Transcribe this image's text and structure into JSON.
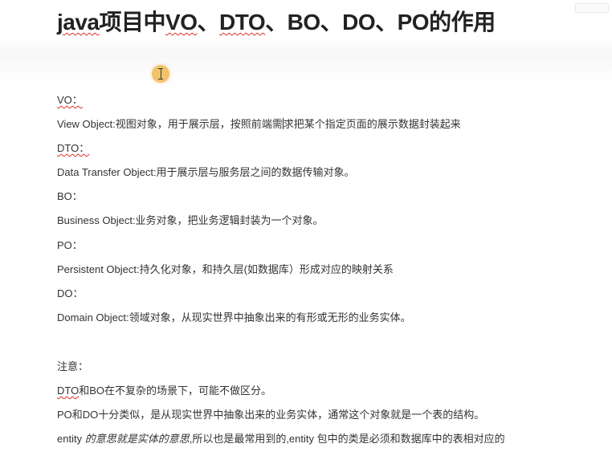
{
  "title": {
    "part1": "java",
    "part2": "项目中",
    "part3": "VO",
    "part4": "、",
    "part5": "DTO",
    "part6": "、BO、DO、PO的作用"
  },
  "sections": {
    "vo_label": "VO：",
    "vo_desc_a": "View Object:视图对象，用于展示层，按照前端需",
    "vo_desc_b": "求把某个指定页面的展示数据封装起来",
    "dto_label": "DTO：",
    "dto_desc": "Data Transfer Object:用于展示层与服务层之间的数据传输对象。",
    "bo_label": "BO：",
    "bo_desc": "Business Object:业务对象，把业务逻辑封装为一个对象。",
    "po_label": "PO：",
    "po_desc": "Persistent Object:持久化对象，和持久层(如数据库）形成对应的映射关系",
    "do_label": "DO：",
    "do_desc": "Domain Object:领域对象，从现实世界中抽象出来的有形或无形的业务实体。"
  },
  "notes": {
    "label": "注意：",
    "line1_a": "DTO",
    "line1_b": "和BO在不复杂的场景下，可能不做区分。",
    "line2": "PO和DO十分类似，是从现实世界中抽象出来的业务实体，通常这个对象就是一个表的结构。",
    "line3_a": "entity ",
    "line3_b": "的意思就是实体的意思",
    "line3_c": ",所以也是最常用到的,entity 包中的类是必须和数据库中的表相对应的"
  },
  "cursor": {
    "icon": "text-cursor-icon",
    "highlight_color": "#f2c26b"
  },
  "colors": {
    "spellcheck_underline": "#d93025"
  }
}
